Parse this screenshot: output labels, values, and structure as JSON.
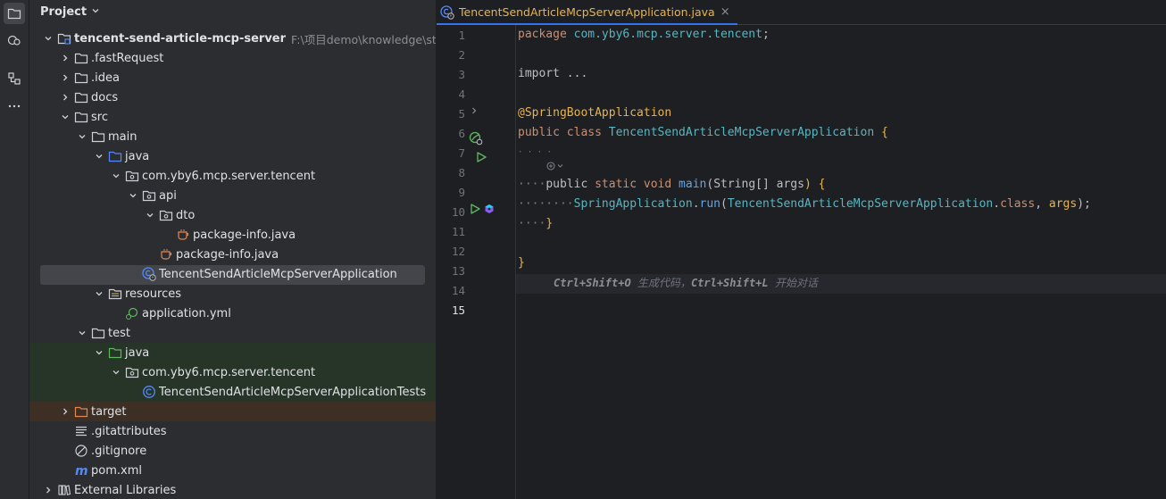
{
  "project_panel": {
    "title": "Project",
    "tree": [
      {
        "label": "tencent-send-article-mcp-server",
        "path": "F:\\项目demo\\knowledge\\study",
        "icon": "module-folder-icon",
        "arrow": "down",
        "bold": true
      },
      {
        "label": ".fastRequest",
        "icon": "folder-icon",
        "arrow": "right"
      },
      {
        "label": ".idea",
        "icon": "folder-icon",
        "arrow": "right"
      },
      {
        "label": "docs",
        "icon": "folder-icon",
        "arrow": "right"
      },
      {
        "label": "src",
        "icon": "folder-icon",
        "arrow": "down"
      },
      {
        "label": "main",
        "icon": "folder-icon",
        "arrow": "down"
      },
      {
        "label": "java",
        "icon": "source-folder-icon",
        "arrow": "down"
      },
      {
        "label": "com.yby6.mcp.server.tencent",
        "icon": "package-icon",
        "arrow": "down"
      },
      {
        "label": "api",
        "icon": "package-icon",
        "arrow": "down"
      },
      {
        "label": "dto",
        "icon": "package-icon",
        "arrow": "down"
      },
      {
        "label": "package-info.java",
        "icon": "java-file-icon",
        "arrow": "none"
      },
      {
        "label": "package-info.java",
        "icon": "java-file-icon",
        "arrow": "none"
      },
      {
        "label": "TencentSendArticleMcpServerApplication",
        "icon": "spring-class-icon",
        "arrow": "none",
        "selected": true
      },
      {
        "label": "resources",
        "icon": "resources-folder-icon",
        "arrow": "down"
      },
      {
        "label": "application.yml",
        "icon": "yaml-file-icon",
        "arrow": "none"
      },
      {
        "label": "test",
        "icon": "folder-icon",
        "arrow": "down"
      },
      {
        "label": "java",
        "icon": "test-folder-icon",
        "arrow": "down",
        "test": true
      },
      {
        "label": "com.yby6.mcp.server.tencent",
        "icon": "package-icon",
        "arrow": "down",
        "test": true
      },
      {
        "label": "TencentSendArticleMcpServerApplicationTests",
        "icon": "class-icon",
        "arrow": "none",
        "test": true
      },
      {
        "label": "target",
        "icon": "excluded-folder-icon",
        "arrow": "right",
        "excluded": true
      },
      {
        "label": ".gitattributes",
        "icon": "text-file-icon",
        "arrow": "none"
      },
      {
        "label": ".gitignore",
        "icon": "ignore-file-icon",
        "arrow": "none"
      },
      {
        "label": "pom.xml",
        "icon": "maven-icon",
        "arrow": "none"
      },
      {
        "label": "External Libraries",
        "icon": "libraries-icon",
        "arrow": "right"
      }
    ]
  },
  "editor": {
    "tab_label": "TencentSendArticleMcpServerApplication.java",
    "tab_close": "×",
    "current_line": "15",
    "lines": {
      "l1_kw": "package",
      "l1_pkg": "com.yby6.mcp.server.tencent",
      "l1_end": ";",
      "l3_kw": "import",
      "l3_rest": " ...",
      "l7": "@SpringBootApplication",
      "l8_kw": "public class",
      "l8_name": "TencentSendArticleMcpServerApplication",
      "l8_end": " {",
      "l10_kw1": "public",
      "l10_kw2": "static",
      "l10_kw3": "void",
      "l10_fn": "main",
      "l10_sig1": "(",
      "l10_type": "String",
      "l10_sig2": "[] ",
      "l10_arg": "args",
      "l10_sig3": ") {",
      "l11_cls": "SpringApplication",
      "l11_dot": ".",
      "l11_fn": "run",
      "l11_p1": "(",
      "l11_cls2": "TencentSendArticleMcpServerApplication",
      "l11_dot2": ".",
      "l11_kw": "class",
      "l11_comma": ", ",
      "l11_arg": "args",
      "l11_end": ");",
      "l12": "}",
      "l14": "}",
      "l15_key1": "Ctrl+Shift+O",
      "l15_t1": " 生成代码，",
      "l15_key2": "Ctrl+Shift+L",
      "l15_t2": " 开始对话"
    },
    "line_numbers": [
      "1",
      "2",
      "3",
      "4",
      "5",
      "6",
      "7",
      "8",
      "9",
      "10",
      "11",
      "12",
      "13",
      "14",
      "15"
    ]
  },
  "colors": {
    "accent": "#3574f0",
    "selection": "#43454a",
    "test_bg": "#273428",
    "excluded_bg": "#3d2f24"
  }
}
